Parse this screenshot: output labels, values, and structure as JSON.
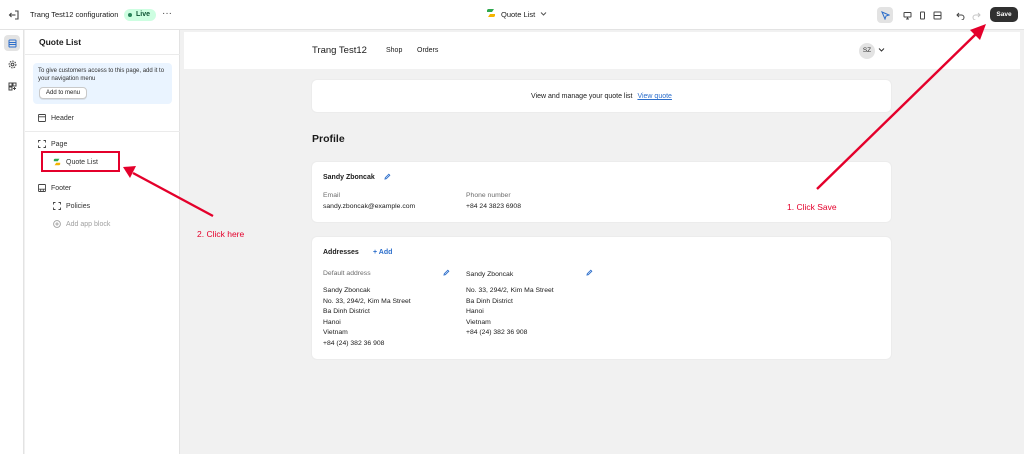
{
  "topbar": {
    "title": "Trang Test12 configuration",
    "status_badge": "Live",
    "more": "···",
    "center_label": "Quote List",
    "save_label": "Save"
  },
  "sidebar": {
    "title": "Quote List",
    "note_text": "To give customers access to this page, add it to your navigation menu",
    "note_button": "Add to menu",
    "header_label": "Header",
    "page_label": "Page",
    "quote_list_label": "Quote List",
    "footer_label": "Footer",
    "policies_label": "Policies",
    "add_app_block_label": "Add app block"
  },
  "store": {
    "name": "Trang Test12",
    "nav": [
      "Shop",
      "Orders"
    ],
    "avatar_initials": "SZ"
  },
  "banner": {
    "text": "View and manage your quote list",
    "link": "View quote"
  },
  "profile": {
    "heading": "Profile",
    "name": "Sandy Zboncak",
    "email_label": "Email",
    "email": "sandy.zboncak@example.com",
    "phone_label": "Phone number",
    "phone": "+84 24 3823 6908"
  },
  "addresses": {
    "heading": "Addresses",
    "add_label": "+ Add",
    "default_label": "Default address",
    "default_lines": [
      "Sandy Zboncak",
      "No. 33, 294/2, Kim Ma Street",
      "Ba Dinh District",
      "Hanoi",
      "Vietnam",
      "+84 (24) 382 36 908"
    ],
    "second_name": "Sandy Zboncak",
    "second_lines": [
      "No. 33, 294/2, Kim Ma Street",
      "Ba Dinh District",
      "Hanoi",
      "Vietnam",
      "+84 (24) 382 36 908"
    ]
  },
  "annotations": {
    "click_save": "1. Click Save",
    "click_here": "2. Click here",
    "color": "#e4002b"
  },
  "colors": {
    "accent_link": "#2c6ecb",
    "live_badge_bg": "#cdfee1",
    "save_button_bg": "#303030"
  }
}
